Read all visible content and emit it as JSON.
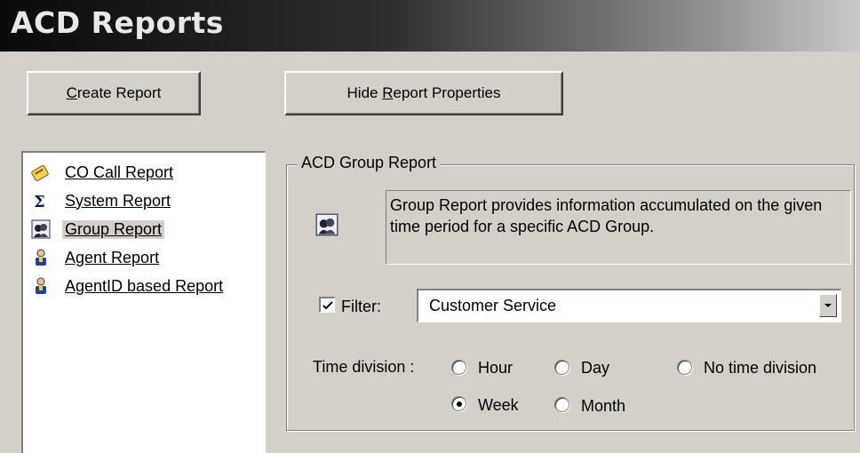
{
  "window": {
    "title": "ACD Reports"
  },
  "toolbar": {
    "create_prefix": "",
    "create_mnemonic": "C",
    "create_rest": "reate Report",
    "hide_prefix": "Hide ",
    "hide_mnemonic": "R",
    "hide_rest": "eport Properties"
  },
  "report_list": {
    "items": [
      {
        "label": "CO Call Report",
        "icon": "phone-note-icon"
      },
      {
        "label": "System Report",
        "icon": "sigma-icon"
      },
      {
        "label": "Group Report",
        "icon": "group-icon",
        "selected": true
      },
      {
        "label": "Agent Report",
        "icon": "agent-icon"
      },
      {
        "label": "AgentID based Report",
        "icon": "agent-icon"
      }
    ]
  },
  "properties": {
    "legend": "ACD Group Report",
    "description": "Group Report provides information accumulated on the given time period for a specific ACD Group.",
    "filter_label": "Filter:",
    "filter_checked": true,
    "filter_value": "Customer Service",
    "time_division_label": "Time division :",
    "time_options": [
      {
        "label": "Hour",
        "checked": false
      },
      {
        "label": "Day",
        "checked": false
      },
      {
        "label": "No time division",
        "checked": false
      },
      {
        "label": "Week",
        "checked": true
      },
      {
        "label": "Month",
        "checked": false
      }
    ]
  }
}
